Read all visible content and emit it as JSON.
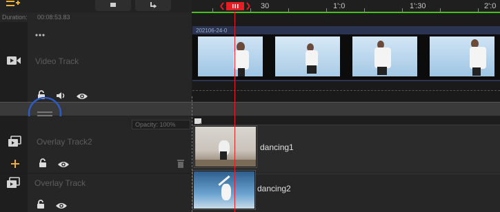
{
  "header": {
    "duration_label": "Duration:",
    "duration_value": "00:08:53.83"
  },
  "ruler": {
    "marks": [
      "30",
      "1':0",
      "1':30",
      "2':0"
    ]
  },
  "tracks": {
    "video": {
      "name": "Video Track",
      "clip_label": "202106-24-0"
    },
    "overlay2": {
      "name": "Overlay Track2",
      "opacity_label": "Opacity: 100%",
      "clip_label": "dancing1"
    },
    "overlay": {
      "name": "Overlay Track",
      "clip_label": "dancing2"
    }
  },
  "colors": {
    "playhead": "#e31e24",
    "accent": "#f2b233",
    "ruler_line": "#46c21a",
    "splitter_ring": "#2c5cc8"
  },
  "icons": {
    "top_left": "add-track-icon",
    "top_btn1": "lock-icon",
    "top_btn2": "redo-icon",
    "video_track": "film-camera-icon",
    "overlay_track": "overlay-media-icon",
    "add": "plus-icon",
    "lock": "lock-icon",
    "volume": "speaker-icon",
    "visible": "eye-icon",
    "delete": "trash-icon",
    "splitter": "drag-handle-icon"
  }
}
